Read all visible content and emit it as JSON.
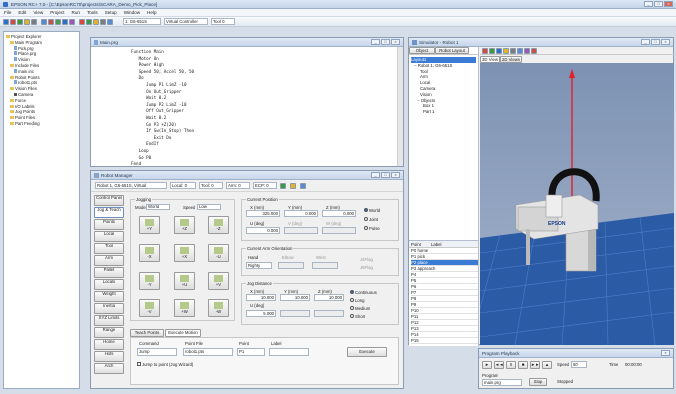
{
  "app": {
    "title": "EPSON RC+ 7.0 - [C:\\EpsonRC70\\projects\\SCARA_Demo_Pick_Place]",
    "window_buttons": [
      "_",
      "□",
      "×"
    ],
    "menu": [
      "File",
      "Edit",
      "View",
      "Project",
      "Run",
      "Tools",
      "Setup",
      "Window",
      "Help"
    ],
    "toolbar": {
      "robot_label": "1: G6-651S",
      "combo_value": "Virtual Controller",
      "speed_value": "Tool 0",
      "colors": [
        "#2f6fc9",
        "#d94a3c",
        "#3a9b46",
        "#e0b52c",
        "#7d7d7d",
        "#5a8ad0",
        "#c6534a",
        "#4d9c52",
        "#2f6fc9",
        "#9b59b6",
        "#d94a3c",
        "#3a9b46",
        "#e0b52c",
        "#7d7d7d",
        "#5a8ad0"
      ]
    }
  },
  "project_explorer": {
    "items": [
      "Project Explorer",
      "Main Program",
      "Pick.prg",
      "Place.prg",
      "Vision",
      "Include Files",
      "main.inc",
      "Robot Points",
      "robot1.pts",
      "Vision Files",
      "Camera",
      "Force",
      "I/O Labels",
      "Jog Points",
      "Point Files",
      "Part Feeding"
    ]
  },
  "code_editor": {
    "title": "Main.prg",
    "lines": [
      "Function Main",
      "   Motor On",
      "   Power High",
      "   Speed 50; Accel 50, 50",
      "   Do",
      "      Jump P1 LimZ -10",
      "      On Out_Gripper",
      "      Wait 0.2",
      "      Jump P2 LimZ -10",
      "      Off Out_Gripper",
      "      Wait 0.2",
      "      Go P3 +Z(20)",
      "      If Sw(In_Stop) Then",
      "         Exit Do",
      "      EndIf",
      "   Loop",
      "   Go P0",
      "Fend"
    ]
  },
  "jog_teach": {
    "title": "Robot Manager",
    "toolbar": {
      "robot": "Robot 1, G6-651S, Virtual",
      "local": "Local: 0",
      "tool": "Tool: 0",
      "arm": "Arm: 0",
      "ecp": "ECP: 0"
    },
    "sidebar_items": [
      "Control Panel",
      "Jog & Teach",
      "Points",
      "Local",
      "Tool",
      "Arm",
      "Pallet",
      "Locals",
      "Weight",
      "Inertia",
      "XYZ Limits",
      "Range",
      "Home",
      "Hofs",
      "Arch"
    ],
    "active_sidebar_index": 1,
    "jogging": {
      "label": "Jogging",
      "mode_label": "Mode",
      "mode_value": "World",
      "speed_label": "Speed",
      "speed_value": "Low",
      "buttons": [
        "+Y",
        "+Z",
        "-Z",
        "-X",
        "+X",
        "-U",
        "-Y",
        "+U",
        "+V",
        "-V",
        "+W",
        "-W"
      ]
    },
    "current_position": {
      "label": "Current Position",
      "headers": [
        "X (mm)",
        "Y (mm)",
        "Z (mm)"
      ],
      "values": [
        "325.000",
        "0.000",
        "0.000"
      ],
      "u_label": "U (deg)",
      "u_value": "0.000",
      "v_label": "V (deg)",
      "w_label": "W (deg)",
      "opt_world": "World",
      "opt_joint": "Joint",
      "opt_pulse": "Pulse"
    },
    "current_arm": {
      "label": "Current Arm Orientation",
      "hand_label": "Hand",
      "hand_value": "Righty",
      "elbow_label": "Elbow",
      "wrist_label": "Wrist",
      "j4flag_label": "J4Flag",
      "j6flag_label": "J6Flag"
    },
    "jog_distance": {
      "label": "Jog Distance",
      "cont_label": "Continuous",
      "opt_long": "Long",
      "opt_medium": "Medium",
      "opt_short": "Short",
      "headers": [
        "X (mm)",
        "Y (mm)",
        "Z (mm)"
      ],
      "values": [
        "10.000",
        "10.000",
        "10.000"
      ],
      "rot_label": "U (deg)",
      "rot_value": "5.000"
    },
    "tabs": [
      "Teach Points",
      "Execute Motion"
    ],
    "active_tab_index": 1,
    "teach": {
      "command_label": "Command",
      "point_file_label": "Point File",
      "point_label": "Point",
      "label_label": "Label",
      "command_value": "Jump",
      "point_file_value": "robot1.pts",
      "point_value": "P1",
      "label_value": "",
      "execute_button": "Execute",
      "checkbox_label": "Jump to point (Jog Wizard)"
    }
  },
  "simulator": {
    "title": "Simulator - Robot 1",
    "tabs": [
      "Object",
      "Robot Layout"
    ],
    "toolbar_tabs": [
      "3D View",
      "2D Views"
    ],
    "tree": [
      "Layout1",
      "Robot 1, G6-651S",
      "Tool",
      "Arm",
      "Local",
      "Camera",
      "Vision",
      "Objects",
      "Box 1",
      "Part 1"
    ],
    "points_header": [
      "Point",
      "Label"
    ],
    "points": [
      "P0 home",
      "P1 pick",
      "P2 place",
      "P3 approach",
      "P4",
      "P5",
      "P6",
      "P7",
      "P8",
      "P9",
      "P10",
      "P11",
      "P12",
      "P13",
      "P14",
      "P15",
      "P16",
      "P17",
      "P18",
      "P19"
    ],
    "selected_point_index": 2,
    "robot_brand": "EPSON",
    "robot_colors": {
      "body": "#dcdcdc",
      "cable": "#111111",
      "grid": "#2c5ba6",
      "grid_line": "#4f7cc8",
      "sky_top": "#7d92b3",
      "sky_bottom": "#a6b5cc"
    }
  },
  "playback": {
    "title": "Program Playback",
    "buttons": [
      "►",
      "◄◄",
      "II",
      "■",
      "►►",
      "▲"
    ],
    "speed_label": "Speed",
    "speed_value": "50",
    "program_label": "Program",
    "program_value": "main.prg",
    "elapsed_label": "Time",
    "elapsed_value": "00:00:00",
    "status": "Stop",
    "status2": "Stopped"
  }
}
